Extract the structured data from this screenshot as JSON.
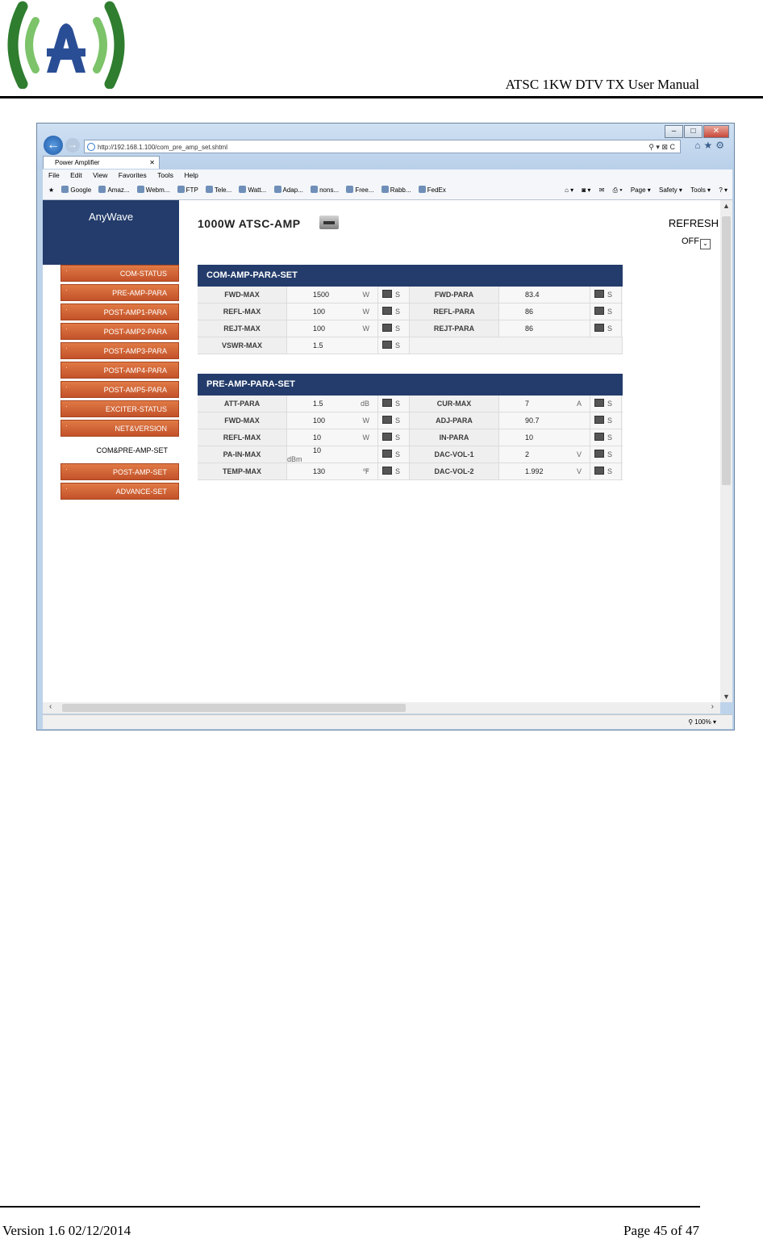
{
  "document": {
    "header_title": "ATSC 1KW DTV TX User Manual",
    "footer_version": "Version 1.6 02/12/2014",
    "footer_page": "Page 45 of 47"
  },
  "browser": {
    "url": "http://192.168.1.100/com_pre_amp_set.shtml",
    "tab_title": "Power Amplifier",
    "menu": [
      "File",
      "Edit",
      "View",
      "Favorites",
      "Tools",
      "Help"
    ],
    "favorites": [
      "Google",
      "Amaz...",
      "Webm...",
      "FTP",
      "Tele...",
      "Watt...",
      "Adap...",
      "nons...",
      "Free...",
      "Rabb...",
      "FedEx"
    ],
    "command_bar": [
      "Page ▾",
      "Safety ▾",
      "Tools ▾"
    ],
    "zoom": "100%"
  },
  "page": {
    "brand": "AnyWave",
    "title": "1000W ATSC-AMP",
    "refresh_label": "REFRESH",
    "refresh_value": "OFF",
    "nav_top": [
      "COM-STATUS",
      "PRE-AMP-PARA",
      "POST-AMP1-PARA",
      "POST-AMP2-PARA",
      "POST-AMP3-PARA",
      "POST-AMP4-PARA",
      "POST-AMP5-PARA",
      "EXCITER-STATUS",
      "NET&VERSION"
    ],
    "nav_active": "COM&PRE-AMP-SET",
    "nav_bottom": [
      "POST-AMP-SET",
      "ADVANCE-SET"
    ],
    "set_button": "S",
    "com_panel": {
      "title": "COM-AMP-PARA-SET",
      "rows": [
        {
          "l1": "FWD-MAX",
          "v1": "1500",
          "u1": "W",
          "l2": "FWD-PARA",
          "v2": "83.4",
          "u2": ""
        },
        {
          "l1": "REFL-MAX",
          "v1": "100",
          "u1": "W",
          "l2": "REFL-PARA",
          "v2": "86",
          "u2": ""
        },
        {
          "l1": "REJT-MAX",
          "v1": "100",
          "u1": "W",
          "l2": "REJT-PARA",
          "v2": "86",
          "u2": ""
        },
        {
          "l1": "VSWR-MAX",
          "v1": "1.5",
          "u1": ""
        }
      ]
    },
    "pre_panel": {
      "title": "PRE-AMP-PARA-SET",
      "rows": [
        {
          "l1": "ATT-PARA",
          "v1": "1.5",
          "u1": "dB",
          "l2": "CUR-MAX",
          "v2": "7",
          "u2": "A"
        },
        {
          "l1": "FWD-MAX",
          "v1": "100",
          "u1": "W",
          "l2": "ADJ-PARA",
          "v2": "90.7",
          "u2": ""
        },
        {
          "l1": "REFL-MAX",
          "v1": "10",
          "u1": "W",
          "l2": "IN-PARA",
          "v2": "10",
          "u2": ""
        },
        {
          "l1": "PA-IN-MAX",
          "v1": "10",
          "u1": "dBm",
          "l2": "DAC-VOL-1",
          "v2": "2",
          "u2": "V"
        },
        {
          "l1": "TEMP-MAX",
          "v1": "130",
          "u1": "℉",
          "l2": "DAC-VOL-2",
          "v2": "1.992",
          "u2": "V"
        }
      ]
    }
  }
}
